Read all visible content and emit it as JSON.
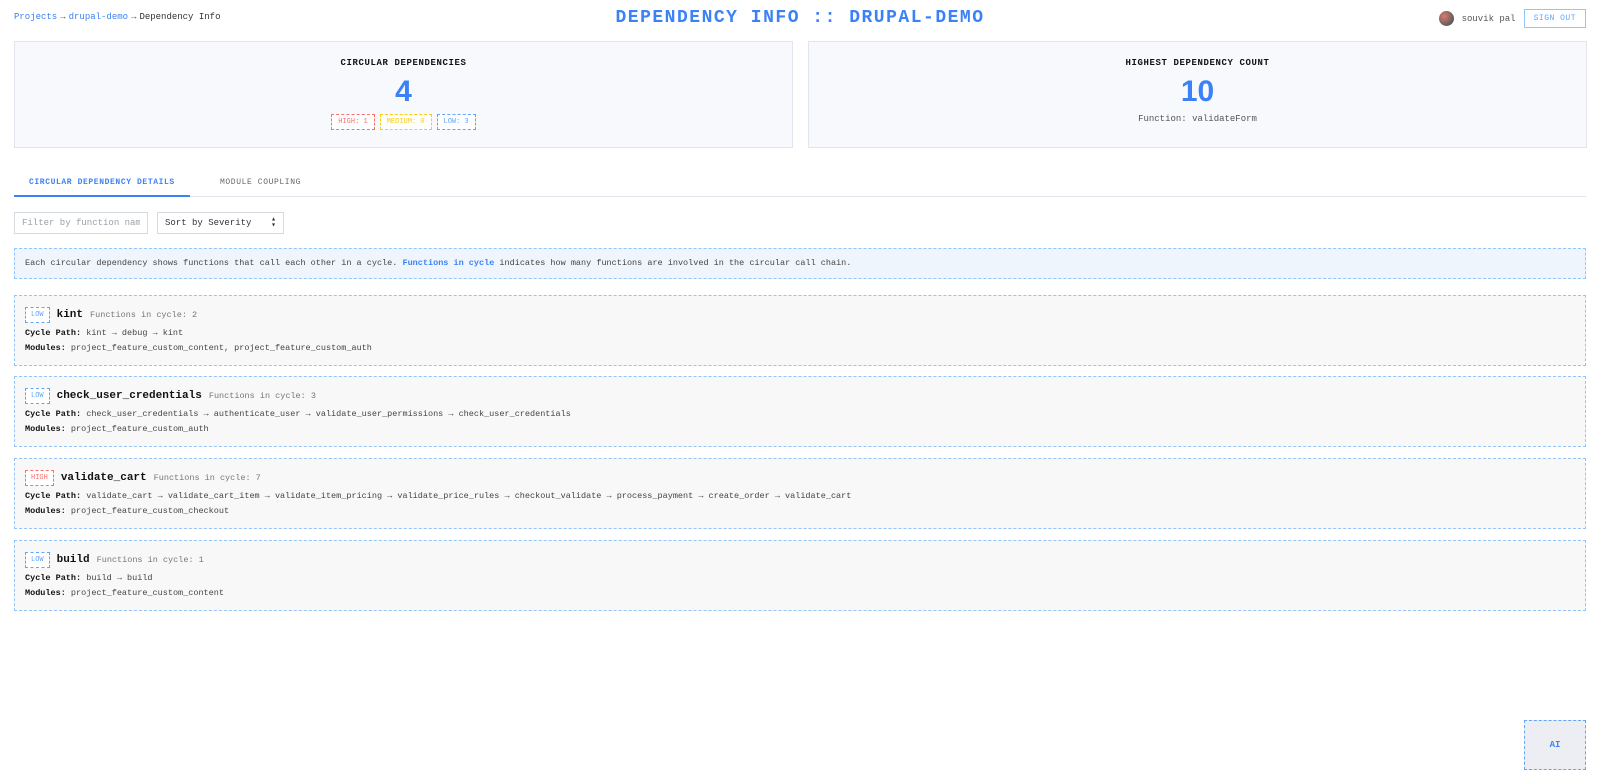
{
  "breadcrumb": {
    "items": [
      "Projects",
      "drupal-demo",
      "Dependency Info"
    ],
    "separator": "→"
  },
  "page_title": "DEPENDENCY INFO :: DRUPAL-DEMO",
  "user": {
    "name": "souvik pal",
    "signout_label": "SIGN OUT"
  },
  "stats": {
    "circular": {
      "title": "CIRCULAR DEPENDENCIES",
      "value": "4",
      "badges": {
        "high": "HIGH: 1",
        "medium": "MEDIUM: 0",
        "low": "LOW: 3"
      }
    },
    "highest": {
      "title": "HIGHEST DEPENDENCY COUNT",
      "value": "10",
      "subtitle": "Function: validateForm"
    }
  },
  "tabs": [
    {
      "label": "CIRCULAR DEPENDENCY DETAILS",
      "active": true
    },
    {
      "label": "MODULE COUPLING",
      "active": false
    }
  ],
  "filters": {
    "search_placeholder": "Filter by function name...",
    "sort_value": "Sort by Severity"
  },
  "info": {
    "prefix": "Each circular dependency shows functions that call each other in a cycle.",
    "highlight": "Functions in cycle",
    "suffix": "indicates how many functions are involved in the circular call chain."
  },
  "labels": {
    "cycle_path": "Cycle Path:",
    "modules": "Modules:"
  },
  "cycles": [
    {
      "severity": "LOW",
      "name": "kint",
      "count": "Functions in cycle: 2",
      "path": "kint → debug → kint",
      "modules": "project_feature_custom_content, project_feature_custom_auth"
    },
    {
      "severity": "LOW",
      "name": "check_user_credentials",
      "count": "Functions in cycle: 3",
      "path": "check_user_credentials → authenticate_user → validate_user_permissions → check_user_credentials",
      "modules": "project_feature_custom_auth"
    },
    {
      "severity": "HIGH",
      "name": "validate_cart",
      "count": "Functions in cycle: 7",
      "path": "validate_cart → validate_cart_item → validate_item_pricing → validate_price_rules → checkout_validate → process_payment → create_order → validate_cart",
      "modules": "project_feature_custom_checkout"
    },
    {
      "severity": "LOW",
      "name": "build",
      "count": "Functions in cycle: 1",
      "path": "build → build",
      "modules": "project_feature_custom_content"
    }
  ],
  "ai_label": "AI",
  "colors": {
    "accent": "#3b82f6",
    "high": "#f87171",
    "medium": "#facc15",
    "low": "#60a5fa"
  }
}
